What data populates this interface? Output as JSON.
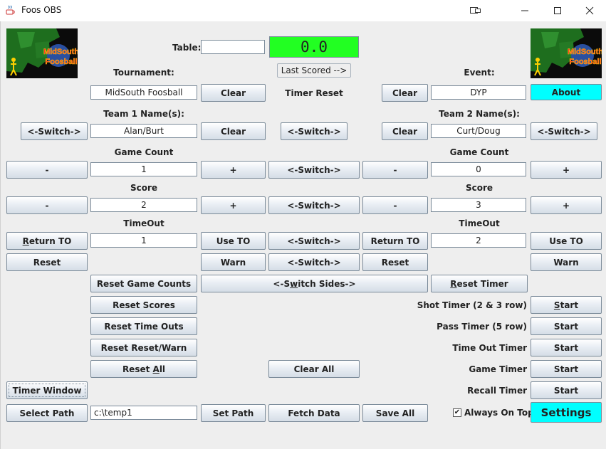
{
  "window": {
    "title": "Foos OBS"
  },
  "header": {
    "table_label": "Table:",
    "table_value": "",
    "score_display": "0.0",
    "last_scored": "Last Scored -->",
    "tournament_label": "Tournament:",
    "tournament_value": "MidSouth Foosball",
    "event_label": "Event:",
    "event_value": "DYP",
    "timer_reset_label": "Timer Reset",
    "about": "About",
    "logo_text_top": "MidSouth",
    "logo_text_bottom": "Foosball"
  },
  "team1": {
    "names_label": "Team 1 Name(s):",
    "names_value": "Alan/Burt",
    "game_count": "1",
    "score": "2",
    "timeout": "1"
  },
  "team2": {
    "names_label": "Team 2 Name(s):",
    "names_value": "Curt/Doug",
    "game_count": "0",
    "score": "3",
    "timeout": "2"
  },
  "labels": {
    "game_count": "Game Count",
    "score": "Score",
    "timeout": "TimeOut"
  },
  "buttons": {
    "clear": "Clear",
    "switch": "<-Switch->",
    "minus": "-",
    "plus": "+",
    "return_to_pre": "",
    "return_to_u": "R",
    "return_to_post": "eturn TO",
    "use_to_pre": "Use TO",
    "reset": "Reset",
    "warn": "Warn",
    "reset_game_counts": "Reset Game Counts",
    "switch_sides_pre": "<-S",
    "switch_sides_u": "w",
    "switch_sides_post": "itch Sides->",
    "reset_timer_pre": "",
    "reset_timer_u": "R",
    "reset_timer_post": "eset Timer",
    "reset_scores": "Reset Scores",
    "reset_time_outs": "Reset Time Outs",
    "reset_reset_warn": "Reset Reset/Warn",
    "reset_all_pre": "Reset ",
    "reset_all_u": "A",
    "reset_all_post": "ll",
    "clear_all": "Clear All",
    "timer_window": "Timer Window",
    "select_path": "Select Path",
    "set_path": "Set Path",
    "fetch_data": "Fetch Data",
    "save_all": "Save All",
    "settings": "Settings",
    "start_u": "S",
    "start_post": "tart",
    "start": "Start"
  },
  "timers": {
    "shot": "Shot Timer (2 & 3 row)",
    "pass": "Pass Timer (5 row)",
    "timeout": "Time Out Timer",
    "game": "Game Timer",
    "recall": "Recall Timer"
  },
  "path": {
    "value": "c:\\temp1"
  },
  "always_on_top": {
    "label": "Always On Top",
    "checked": true
  },
  "colors": {
    "cyan": "#00ffff",
    "score_green": "#22ff22"
  }
}
